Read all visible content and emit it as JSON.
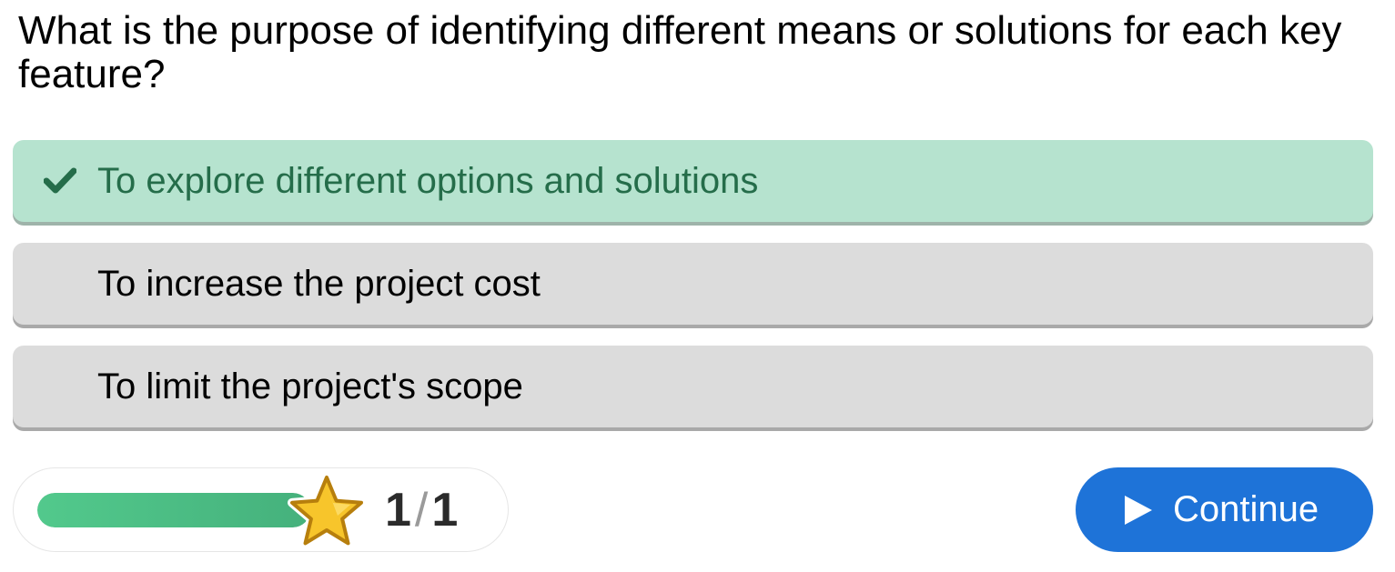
{
  "question": {
    "text": "What is the purpose of identifying different means or solutions for each key feature?"
  },
  "options": [
    {
      "label": "To explore different options and solutions",
      "state": "correct",
      "icon": "check-icon"
    },
    {
      "label": "To increase the project cost",
      "state": "unselected"
    },
    {
      "label": "To limit the project's scope",
      "state": "unselected"
    }
  ],
  "progress": {
    "fraction": 1.0,
    "current": "1",
    "separator": "/",
    "total": "1",
    "icon": "star-icon"
  },
  "continue_button": {
    "label": "Continue",
    "icon": "play-icon"
  },
  "colors": {
    "correct_bg": "#b6e3cf",
    "correct_text": "#256d4a",
    "option_bg": "#dcdcdc",
    "progress_fill": "#4fc28a",
    "star": "#f7c52b",
    "accent": "#1e73d8"
  }
}
